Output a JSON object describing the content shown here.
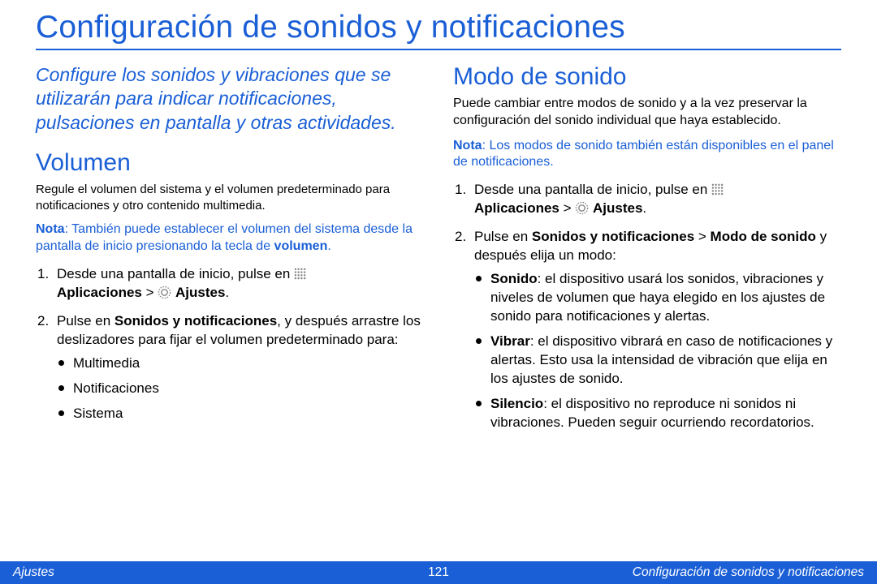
{
  "title": "Configuración de sonidos y notificaciones",
  "intro": "Configure los sonidos y vibraciones que se utilizarán para indicar notificaciones, pulsaciones en pantalla y otras actividades.",
  "left": {
    "heading": "Volumen",
    "para": "Regule el volumen del sistema y el volumen predeterminado para notificaciones y otro contenido multimedia.",
    "note_lead": "Nota",
    "note_sep": ": ",
    "note_body_1": "También puede establecer el volumen del sistema desde la pantalla de inicio presionando la tecla de ",
    "note_bold": "volumen",
    "note_body_2": ".",
    "step1_a": "Desde una pantalla de inicio, pulse en ",
    "step1_b": "Aplicaciones",
    "step1_c": " > ",
    "step1_d": "Ajustes",
    "step1_e": ".",
    "step2_a": "Pulse en ",
    "step2_b": "Sonidos y notificaciones",
    "step2_c": ", y después arrastre los deslizadores para fijar el volumen predeterminado para:",
    "bul1": "Multimedia",
    "bul2": "Notificaciones",
    "bul3": "Sistema"
  },
  "right": {
    "heading": "Modo de sonido",
    "para": "Puede cambiar entre modos de sonido y a la vez preservar la configuración del sonido individual que haya establecido.",
    "note_lead": "Nota",
    "note_sep": ": ",
    "note_body": "Los modos de sonido también están disponibles en el panel de notificaciones.",
    "step1_a": "Desde una pantalla de inicio, pulse en ",
    "step1_b": "Aplicaciones",
    "step1_c": " > ",
    "step1_d": "Ajustes",
    "step1_e": ".",
    "step2_a": "Pulse en ",
    "step2_b": "Sonidos y notificaciones",
    "step2_c": " > ",
    "step2_d": "Modo de sonido",
    "step2_e": " y después elija un modo:",
    "opt1_b": "Sonido",
    "opt1_t": ": el dispositivo usará los sonidos, vibraciones y niveles de volumen que haya elegido en los ajustes de sonido para notificaciones y alertas.",
    "opt2_b": "Vibrar",
    "opt2_t": ": el dispositivo vibrará en caso de notificaciones y alertas. Esto usa la intensidad de vibración que elija en los ajustes de sonido.",
    "opt3_b": "Silencio",
    "opt3_t": ": el dispositivo no reproduce ni sonidos ni vibraciones. Pueden seguir ocurriendo recordatorios."
  },
  "footer": {
    "left": "Ajustes",
    "center": "121",
    "right": "Configuración de sonidos y notificaciones"
  }
}
